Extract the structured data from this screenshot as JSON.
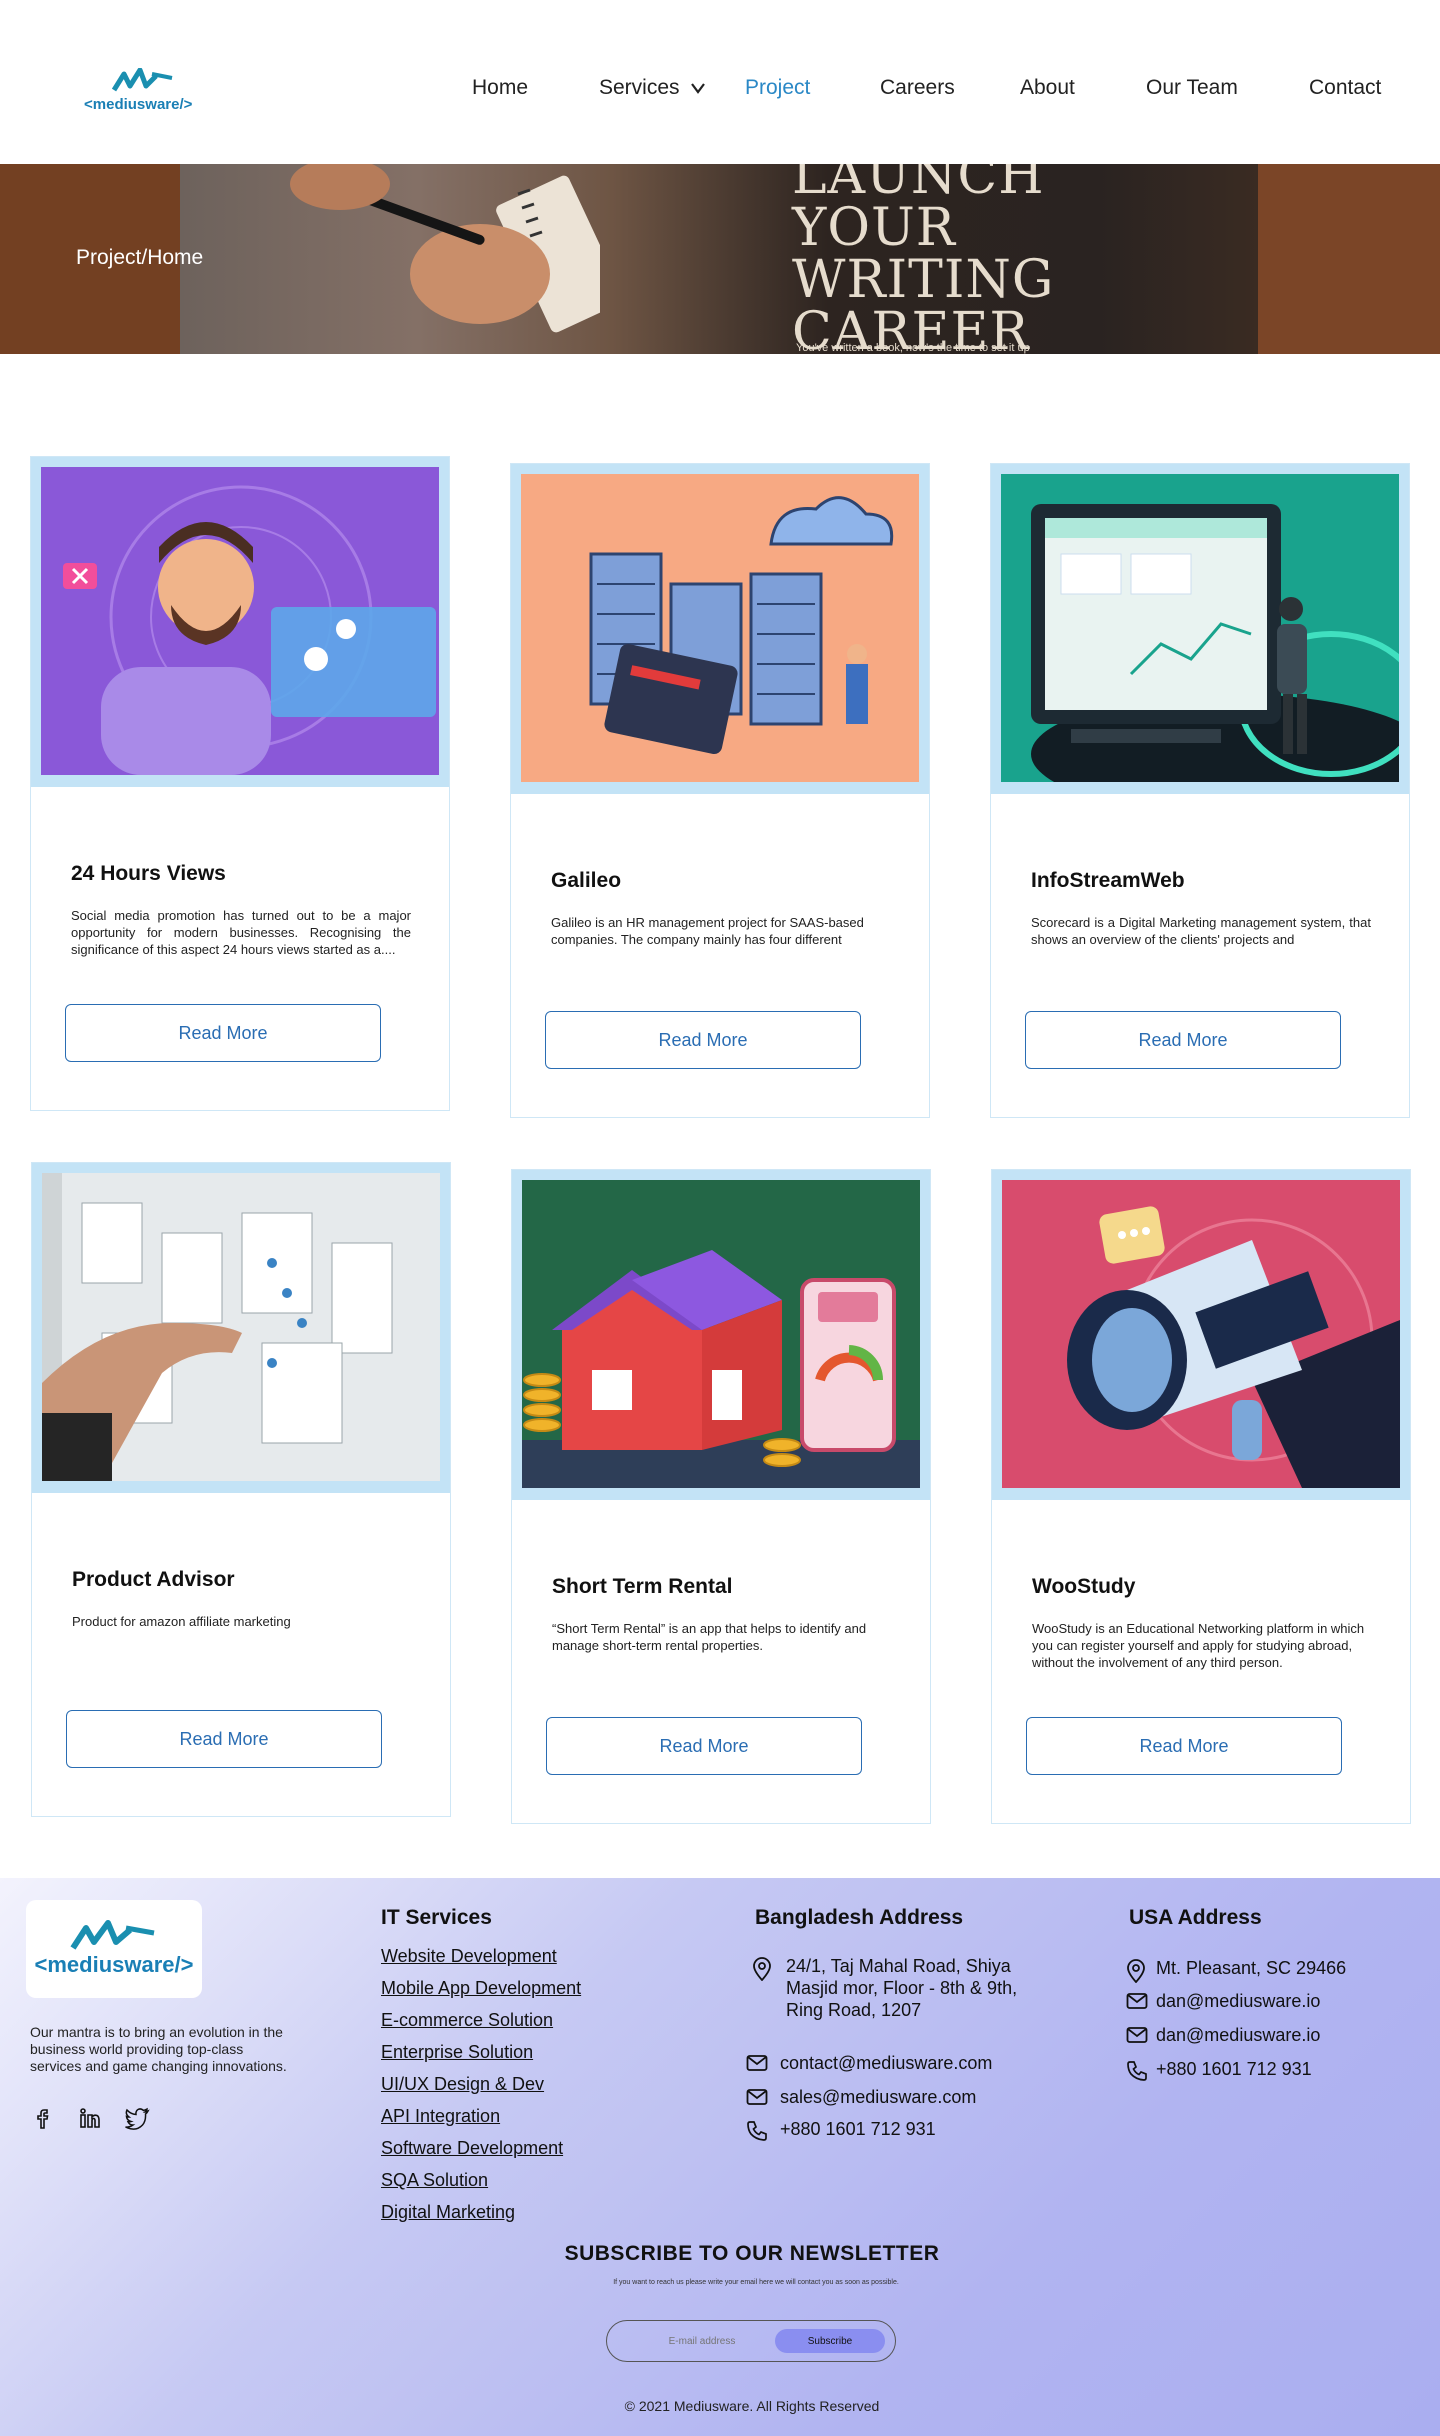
{
  "brand": {
    "name": "<mediusware/>"
  },
  "nav": {
    "home": "Home",
    "services": "Services",
    "project": "Project",
    "careers": "Careers",
    "about": "About",
    "team": "Our Team",
    "contact": "Contact",
    "active": "Project"
  },
  "hero": {
    "breadcrumb": "Project/Home",
    "heading": "LAUNCH\nYOUR\nWRITING\nCAREER",
    "sub": "You've written a book, now's the time to set it up"
  },
  "projects": [
    {
      "title": "24 Hours Views",
      "desc": "Social media promotion has turned out to be a major opportunity for modern businesses. Recognising the significance of this aspect 24 hours views started as a....",
      "button": "Read More"
    },
    {
      "title": "Galileo",
      "desc": "Galileo is an HR management project for SAAS-based companies. The company mainly has four different",
      "button": "Read More"
    },
    {
      "title": "InfoStreamWeb",
      "desc": "Scorecard is a Digital Marketing management system, that shows an overview of the clients' projects and",
      "button": "Read More"
    },
    {
      "title": "Product Advisor",
      "desc": "Product for amazon affiliate marketing",
      "button": "Read More"
    },
    {
      "title": "Short Term Rental",
      "desc": "“Short Term Rental” is an app that helps to identify and manage short-term rental properties.",
      "button": "Read More"
    },
    {
      "title": "WooStudy",
      "desc": "WooStudy is an Educational Networking platform in which you can register yourself and apply for studying abroad, without the involvement of any third person.",
      "button": "Read More"
    }
  ],
  "footer": {
    "logo_text": "<mediusware/>",
    "mantra": "Our mantra is to bring an evolution in the business world providing top-class services and game changing innovations.",
    "social_icons": [
      "facebook-icon",
      "linkedin-icon",
      "twitter-icon"
    ],
    "it_services": {
      "title": "IT Services",
      "links": [
        "Website Development",
        "Mobile App Development",
        "E-commerce Solution",
        "Enterprise Solution",
        "UI/UX Design & Dev",
        "API Integration",
        "Software Development",
        "SQA Solution",
        "Digital Marketing"
      ]
    },
    "bangladesh": {
      "title": "Bangladesh Address",
      "address": "24/1, Taj Mahal Road, Shiya\nMasjid mor, Floor - 8th & 9th,\nRing Road, 1207",
      "email1": "contact@mediusware.com",
      "email2": "sales@mediusware.com",
      "phone": "+880 1601 712 931"
    },
    "usa": {
      "title": "USA Address",
      "address": "Mt. Pleasant, SC 29466",
      "email1": "dan@mediusware.io",
      "email2": "dan@mediusware.io",
      "phone": "+880 1601 712 931"
    },
    "newsletter": {
      "title": "SUBSCRIBE TO OUR NEWSLETTER",
      "note": "If you want to reach us please write your email here we will contact you as soon as possible.",
      "placeholder": "E-mail address",
      "button": "Subscribe"
    },
    "copyright": "© 2021 Mediusware. All Rights Reserved"
  },
  "colors": {
    "accent": "#2a88c6",
    "button_border": "#2a6db3",
    "card_frame": "#c3e3f6",
    "footer": "#b1b4f1"
  }
}
